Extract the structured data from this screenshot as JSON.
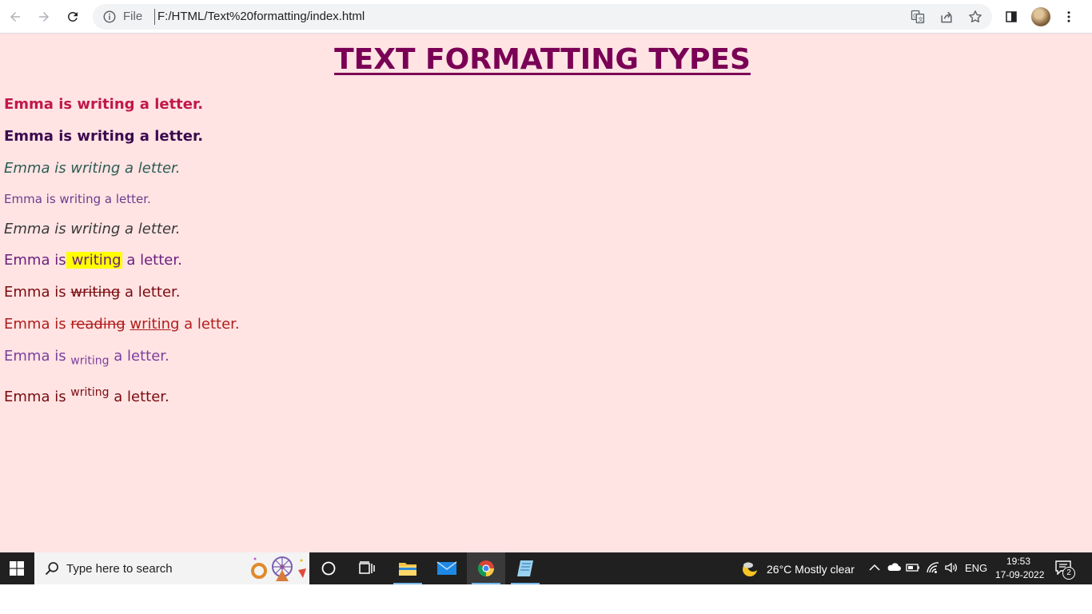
{
  "browser": {
    "url_scheme": "File",
    "url": "F:/HTML/Text%20formatting/index.html"
  },
  "page": {
    "heading": "TEXT FORMATTING TYPES",
    "lines": {
      "bold": "Emma is writing a letter.",
      "strong": "Emma is writing a letter.",
      "italic": "Emma is writing a letter.",
      "small": "Emma is writing a letter.",
      "em": "Emma is writing a letter.",
      "mark": {
        "before": "Emma is",
        "marked": "writing",
        "after": " a letter."
      },
      "del": {
        "before": "Emma is ",
        "deleted": "writing",
        "after": " a letter."
      },
      "ins": {
        "before": "Emma is ",
        "deleted": "reading",
        "inserted": "writing",
        "after": " a letter."
      },
      "sub": {
        "before": "Emma is ",
        "sub": "writing",
        "after": " a letter."
      },
      "sup": {
        "before": "Emma is ",
        "sup": "writing",
        "after": " a letter."
      }
    },
    "colors": {
      "background": "#ffe4e3",
      "heading": "#7a0055",
      "bold": "#c0184a",
      "strong": "#3b0a4f",
      "italic": "#2e5c55",
      "small": "#6a3d8f",
      "em": "#3a3a3a",
      "mark": "#6a2080",
      "del": "#7a0a10",
      "ins": "#b01c1c",
      "sub": "#7b3f9e",
      "sup": "#7a0a10"
    }
  },
  "taskbar": {
    "search_placeholder": "Type here to search",
    "weather": "26°C  Mostly clear",
    "language": "ENG",
    "time": "19:53",
    "date": "17-09-2022",
    "notification_count": "2"
  }
}
